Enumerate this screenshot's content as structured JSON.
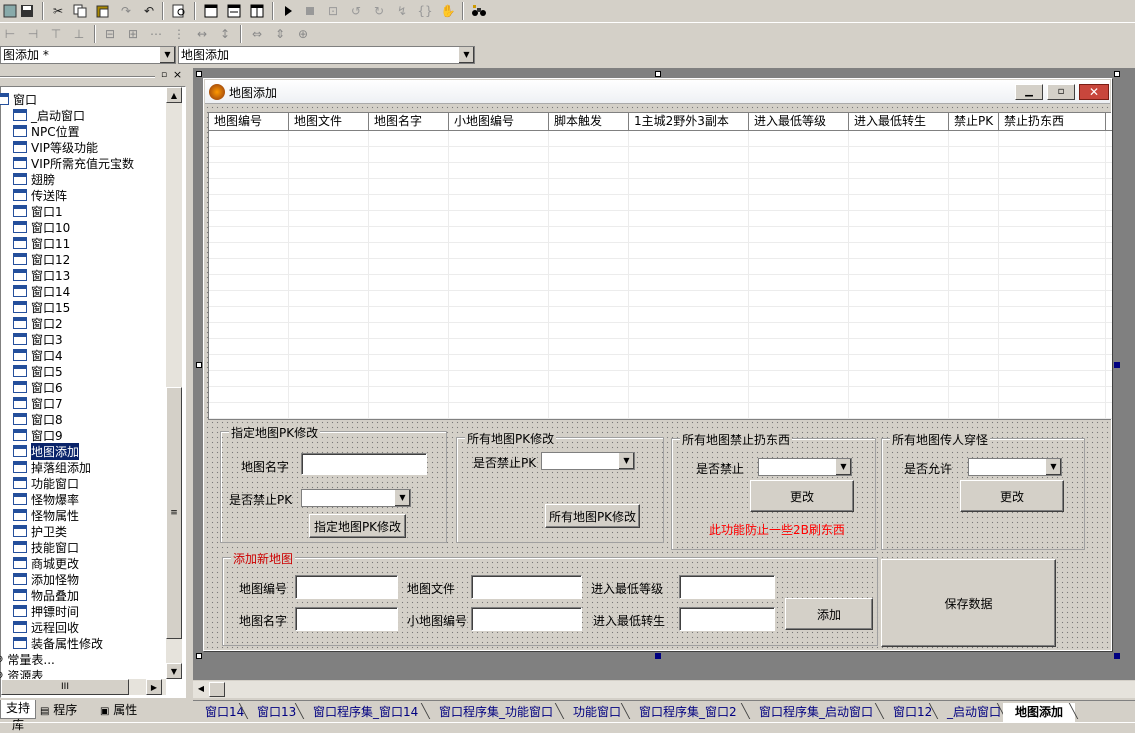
{
  "toolbar": {
    "row1_icons": [
      "save-icon",
      "save-all-icon",
      "cut-icon",
      "copy-icon",
      "paste-icon",
      "redo-icon",
      "undo-icon",
      "find-icon",
      "window-icon",
      "window-list-icon",
      "window-grid-icon",
      "run-icon",
      "stop-icon",
      "step-over-icon",
      "step-into-icon",
      "step-out-icon",
      "step-run-icon",
      "hand-icon",
      "binoculars-icon"
    ],
    "left_combo": "图添加 *",
    "right_combo": "地图添加"
  },
  "tree": {
    "root": "窗口",
    "items": [
      "_启动窗口",
      "NPC位置",
      "VIP等级功能",
      "VIP所需充值元宝数",
      "翅膀",
      "传送阵",
      "窗口1",
      "窗口10",
      "窗口11",
      "窗口12",
      "窗口13",
      "窗口14",
      "窗口15",
      "窗口2",
      "窗口3",
      "窗口4",
      "窗口5",
      "窗口6",
      "窗口7",
      "窗口8",
      "窗口9",
      "地图添加",
      "掉落组添加",
      "功能窗口",
      "怪物爆率",
      "怪物属性",
      "护卫类",
      "技能窗口",
      "商城更改",
      "添加怪物",
      "物品叠加",
      "押镖时间",
      "远程回收",
      "装备属性修改"
    ],
    "selected": "地图添加",
    "after": [
      "常量表...",
      "资源表"
    ],
    "hscroll_label": "III"
  },
  "left_tabs": [
    "支持库",
    "程序",
    "属性"
  ],
  "form": {
    "title": "地图添加",
    "columns": [
      "地图编号",
      "地图文件",
      "地图名字",
      "小地图编号",
      "脚本触发",
      "1主城2野外3副本",
      "进入最低等级",
      "进入最低转生",
      "禁止PK",
      "禁止扔东西"
    ],
    "g1": {
      "caption": "指定地图PK修改",
      "name_label": "地图名字",
      "pk_label": "是否禁止PK",
      "button": "指定地图PK修改"
    },
    "g2": {
      "caption": "所有地图PK修改",
      "pk_label": "是否禁止PK",
      "button": "所有地图PK修改"
    },
    "g3": {
      "caption": "所有地图禁止扔东西",
      "label": "是否禁止",
      "button": "更改",
      "note": "此功能防止一些2B刷东西"
    },
    "g4": {
      "caption": "所有地图传人穿怪",
      "label": "是否允许",
      "button": "更改"
    },
    "g5": {
      "caption": "添加新地图",
      "label_id": "地图编号",
      "label_file": "地图文件",
      "label_level": "进入最低等级",
      "label_name": "地图名字",
      "label_minimap": "小地图编号",
      "label_rebirth": "进入最低转生",
      "button": "添加"
    },
    "save_button": "保存数据"
  },
  "bottom_tabs": [
    "窗口14",
    "窗口13",
    "窗口程序集_窗口14",
    "窗口程序集_功能窗口",
    "功能窗口",
    "窗口程序集_窗口2",
    "窗口程序集_启动窗口",
    "窗口12",
    "_启动窗口",
    "地图添加"
  ],
  "active_tab": "地图添加",
  "colors": {
    "selection": "#0a246a",
    "note_red": "#ff0000",
    "caption_red": "#cc0000",
    "tab_text": "#000080"
  }
}
